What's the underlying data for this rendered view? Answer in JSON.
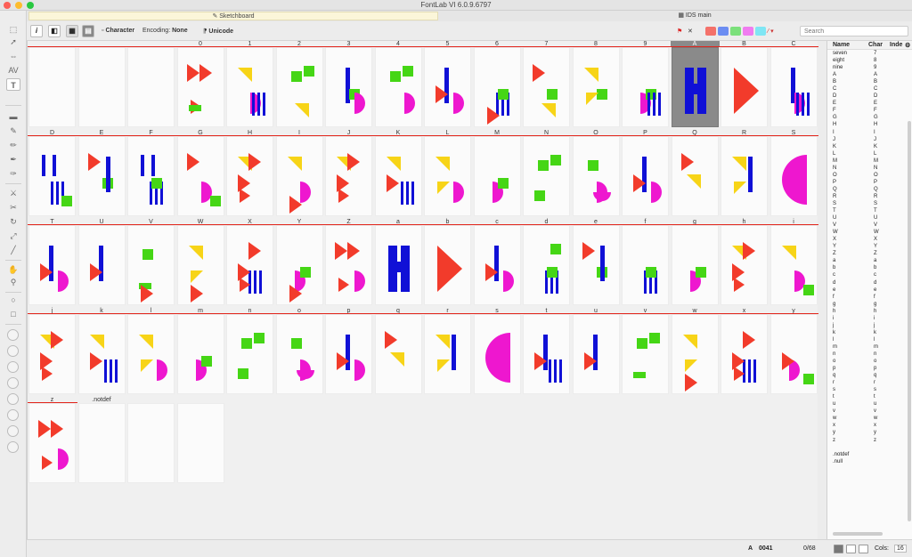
{
  "window": {
    "title": "FontLab VI 6.0.9.6797"
  },
  "tabs": {
    "sketchboard": "Sketchboard",
    "ids_main": "IDS main"
  },
  "toolbar": {
    "character_label": "Character",
    "encoding_label": "Encoding:",
    "encoding_value": "None",
    "unicode_label": "Unicode",
    "search_placeholder": "Search",
    "swatch_colors": [
      "#f4716a",
      "#6c8df2",
      "#7be07b",
      "#f07cf0",
      "#7fe6f4"
    ]
  },
  "colors": {
    "red": "#f23b2b",
    "blue": "#1010d6",
    "green": "#45d615",
    "yellow": "#f7d417",
    "magenta": "#ee17cf"
  },
  "glyphs": [
    {
      "name": "",
      "shapes": []
    },
    {
      "name": "",
      "shapes": []
    },
    {
      "name": "",
      "shapes": []
    },
    {
      "name": "0",
      "shapes": [
        "rtri",
        "rtri2",
        "gbar"
      ]
    },
    {
      "name": "1",
      "shapes": [
        "ytri",
        "mhalf",
        "bbars"
      ]
    },
    {
      "name": "2",
      "shapes": [
        "gsq",
        "gsq2",
        "ytri"
      ]
    },
    {
      "name": "3",
      "shapes": [
        "bvbar",
        "gsq",
        "mhalf"
      ]
    },
    {
      "name": "4",
      "shapes": [
        "gsq",
        "gsq2",
        "mhalf"
      ]
    },
    {
      "name": "5",
      "shapes": [
        "bvbar",
        "rtri",
        "mhalf"
      ]
    },
    {
      "name": "6",
      "shapes": [
        "bbars",
        "gsq",
        "rtri"
      ]
    },
    {
      "name": "7",
      "shapes": [
        "rtri",
        "gsq",
        "ytri"
      ]
    },
    {
      "name": "8",
      "shapes": [
        "ytri",
        "gsq",
        "ytri2"
      ]
    },
    {
      "name": "9",
      "shapes": [
        "mhalf",
        "gsq",
        "bbars"
      ]
    },
    {
      "name": "A",
      "shapes": [
        "bbig"
      ],
      "selected": true
    },
    {
      "name": "B",
      "shapes": [
        "rbig"
      ]
    },
    {
      "name": "C",
      "shapes": [
        "bvbar",
        "mhalf",
        "bbars"
      ]
    },
    {
      "name": "D",
      "shapes": [
        "bbars",
        "bbars2",
        "gsq"
      ]
    },
    {
      "name": "E",
      "shapes": [
        "rtri",
        "gsq",
        "bvbar"
      ]
    },
    {
      "name": "F",
      "shapes": [
        "bbars",
        "gsq",
        "bbars2"
      ]
    },
    {
      "name": "G",
      "shapes": [
        "rtri",
        "mhalf",
        "gsq"
      ]
    },
    {
      "name": "H",
      "shapes": [
        "ytri",
        "rtri",
        "rtri2"
      ]
    },
    {
      "name": "I",
      "shapes": [
        "ytri",
        "mhalf",
        "rtri"
      ]
    },
    {
      "name": "J",
      "shapes": [
        "ytri",
        "rtri",
        "rtri2"
      ]
    },
    {
      "name": "K",
      "shapes": [
        "ytri",
        "rtri",
        "bbars"
      ]
    },
    {
      "name": "L",
      "shapes": [
        "ytri",
        "ytri2",
        "mhalf"
      ]
    },
    {
      "name": "M",
      "shapes": [
        "mhalf",
        "gsq"
      ]
    },
    {
      "name": "N",
      "shapes": [
        "gsq",
        "gsq2",
        "gsq3"
      ]
    },
    {
      "name": "O",
      "shapes": [
        "gsq",
        "mhalf",
        "mhalf2"
      ]
    },
    {
      "name": "P",
      "shapes": [
        "bvbar",
        "rtri",
        "mhalf"
      ]
    },
    {
      "name": "Q",
      "shapes": [
        "rtri",
        "ytri"
      ]
    },
    {
      "name": "R",
      "shapes": [
        "ytri",
        "ytri2",
        "bvbar"
      ]
    },
    {
      "name": "S",
      "shapes": [
        "mbig"
      ]
    },
    {
      "name": "T",
      "shapes": [
        "bvbar",
        "rtri",
        "mhalf"
      ]
    },
    {
      "name": "U",
      "shapes": [
        "bvbar",
        "rtri"
      ]
    },
    {
      "name": "V",
      "shapes": [
        "gsq",
        "gbar",
        "rtri"
      ]
    },
    {
      "name": "W",
      "shapes": [
        "ytri",
        "ytri2",
        "rtri"
      ]
    },
    {
      "name": "X",
      "shapes": [
        "bbars",
        "rtri",
        "rtri2"
      ]
    },
    {
      "name": "Y",
      "shapes": [
        "mhalf",
        "gsq",
        "rtri"
      ]
    },
    {
      "name": "Z",
      "shapes": [
        "rtri",
        "rtri2",
        "mhalf"
      ]
    },
    {
      "name": "a",
      "shapes": [
        "bbig"
      ]
    },
    {
      "name": "b",
      "shapes": [
        "rbig"
      ]
    },
    {
      "name": "c",
      "shapes": [
        "bvbar",
        "rtri",
        "mhalf"
      ]
    },
    {
      "name": "d",
      "shapes": [
        "bbars",
        "gsq",
        "gsq2"
      ]
    },
    {
      "name": "e",
      "shapes": [
        "rtri",
        "gsq",
        "bvbar"
      ]
    },
    {
      "name": "f",
      "shapes": [
        "bbars",
        "gsq"
      ]
    },
    {
      "name": "g",
      "shapes": [
        "mhalf",
        "gsq"
      ]
    },
    {
      "name": "h",
      "shapes": [
        "ytri",
        "rtri",
        "rtri2"
      ]
    },
    {
      "name": "i",
      "shapes": [
        "ytri",
        "mhalf",
        "gsq"
      ]
    },
    {
      "name": "j",
      "shapes": [
        "ytri",
        "rtri",
        "rtri2"
      ]
    },
    {
      "name": "k",
      "shapes": [
        "ytri",
        "rtri",
        "bbars"
      ]
    },
    {
      "name": "l",
      "shapes": [
        "ytri",
        "ytri2",
        "mhalf"
      ]
    },
    {
      "name": "m",
      "shapes": [
        "mhalf",
        "gsq"
      ]
    },
    {
      "name": "n",
      "shapes": [
        "gsq",
        "gsq2",
        "gsq3"
      ]
    },
    {
      "name": "o",
      "shapes": [
        "gsq",
        "mhalf",
        "mhalf2"
      ]
    },
    {
      "name": "p",
      "shapes": [
        "bvbar",
        "rtri",
        "mhalf"
      ]
    },
    {
      "name": "q",
      "shapes": [
        "rtri",
        "ytri"
      ]
    },
    {
      "name": "r",
      "shapes": [
        "ytri",
        "ytri2",
        "bvbar"
      ]
    },
    {
      "name": "s",
      "shapes": [
        "mbig"
      ]
    },
    {
      "name": "t",
      "shapes": [
        "bvbar",
        "rtri",
        "bbars"
      ]
    },
    {
      "name": "u",
      "shapes": [
        "bvbar",
        "rtri"
      ]
    },
    {
      "name": "v",
      "shapes": [
        "gsq",
        "gbar",
        "gsq2"
      ]
    },
    {
      "name": "w",
      "shapes": [
        "ytri",
        "ytri2",
        "rtri"
      ]
    },
    {
      "name": "x",
      "shapes": [
        "bbars",
        "rtri",
        "rtri2"
      ]
    },
    {
      "name": "y",
      "shapes": [
        "mhalf",
        "rtri",
        "gsq"
      ]
    },
    {
      "name": "z",
      "shapes": [
        "rtri",
        "rtri2",
        "mhalf"
      ]
    },
    {
      "name": ".notdef",
      "shapes": []
    },
    {
      "name": "",
      "shapes": []
    },
    {
      "name": "",
      "shapes": []
    }
  ],
  "glyph_list": {
    "headers": {
      "name": "Name",
      "char": "Char",
      "index": "Inde"
    },
    "rows": [
      [
        "seven",
        "7"
      ],
      [
        "eight",
        "8"
      ],
      [
        "nine",
        "9"
      ],
      [
        "A",
        "A"
      ],
      [
        "B",
        "B"
      ],
      [
        "C",
        "C"
      ],
      [
        "D",
        "D"
      ],
      [
        "E",
        "E"
      ],
      [
        "F",
        "F"
      ],
      [
        "G",
        "G"
      ],
      [
        "H",
        "H"
      ],
      [
        "I",
        "I"
      ],
      [
        "J",
        "J"
      ],
      [
        "K",
        "K"
      ],
      [
        "L",
        "L"
      ],
      [
        "M",
        "M"
      ],
      [
        "N",
        "N"
      ],
      [
        "O",
        "O"
      ],
      [
        "P",
        "P"
      ],
      [
        "Q",
        "Q"
      ],
      [
        "R",
        "R"
      ],
      [
        "S",
        "S"
      ],
      [
        "T",
        "T"
      ],
      [
        "U",
        "U"
      ],
      [
        "V",
        "V"
      ],
      [
        "W",
        "W"
      ],
      [
        "X",
        "X"
      ],
      [
        "Y",
        "Y"
      ],
      [
        "Z",
        "Z"
      ],
      [
        "a",
        "a"
      ],
      [
        "b",
        "b"
      ],
      [
        "c",
        "c"
      ],
      [
        "d",
        "d"
      ],
      [
        "e",
        "e"
      ],
      [
        "f",
        "f"
      ],
      [
        "g",
        "g"
      ],
      [
        "h",
        "h"
      ],
      [
        "i",
        "i"
      ],
      [
        "j",
        "j"
      ],
      [
        "k",
        "k"
      ],
      [
        "l",
        "l"
      ],
      [
        "m",
        "m"
      ],
      [
        "n",
        "n"
      ],
      [
        "o",
        "o"
      ],
      [
        "p",
        "p"
      ],
      [
        "q",
        "q"
      ],
      [
        "r",
        "r"
      ],
      [
        "s",
        "s"
      ],
      [
        "t",
        "t"
      ],
      [
        "u",
        "u"
      ],
      [
        "v",
        "v"
      ],
      [
        "w",
        "w"
      ],
      [
        "x",
        "x"
      ],
      [
        "y",
        "y"
      ],
      [
        "z",
        "z"
      ],
      [
        "",
        ""
      ],
      [
        ".notdef",
        ""
      ],
      [
        ".null",
        ""
      ]
    ]
  },
  "status": {
    "glyph": "A",
    "code": "0041",
    "count": "0/68",
    "cols_label": "Cols:",
    "cols_value": "16"
  }
}
